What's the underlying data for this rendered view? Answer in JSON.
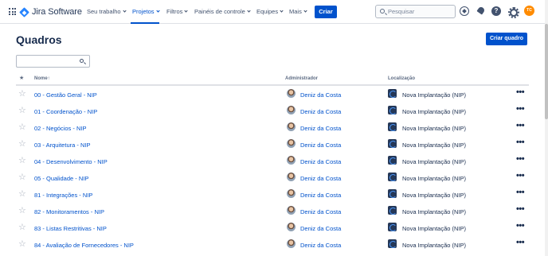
{
  "nav": {
    "brand": "Jira Software",
    "items": [
      {
        "label": "Seu trabalho",
        "dropdown": true
      },
      {
        "label": "Projetos",
        "dropdown": true,
        "active": true
      },
      {
        "label": "Filtros",
        "dropdown": true
      },
      {
        "label": "Painéis de controle",
        "dropdown": true
      },
      {
        "label": "Equipes",
        "dropdown": true
      },
      {
        "label": "Mais",
        "dropdown": true
      }
    ],
    "create_label": "Criar",
    "search_placeholder": "Pesquisar",
    "help_glyph": "?",
    "user_initials": "TC",
    "icons": [
      "app-switcher-icon",
      "compass-icon",
      "notification-bell-icon",
      "help-icon",
      "settings-gear-icon"
    ]
  },
  "page": {
    "title": "Quadros",
    "create_board_label": "Criar quadro",
    "filter_value": "",
    "columns": {
      "star": "★",
      "name": "Nome",
      "name_sort": "↑",
      "admin": "Administrador",
      "location": "Localização"
    },
    "rows": [
      {
        "name": "00 - Gestão Geral - NIP",
        "admin": "Deniz da Costa",
        "location": "Nova Implantação (NIP)"
      },
      {
        "name": "01 - Coordenação - NIP",
        "admin": "Deniz da Costa",
        "location": "Nova Implantação (NIP)"
      },
      {
        "name": "02 - Negócios - NIP",
        "admin": "Deniz da Costa",
        "location": "Nova Implantação (NIP)"
      },
      {
        "name": "03 - Arquitetura - NIP",
        "admin": "Deniz da Costa",
        "location": "Nova Implantação (NIP)"
      },
      {
        "name": "04 - Desenvolvimento - NIP",
        "admin": "Deniz da Costa",
        "location": "Nova Implantação (NIP)"
      },
      {
        "name": "05 - Qualidade - NIP",
        "admin": "Deniz da Costa",
        "location": "Nova Implantação (NIP)"
      },
      {
        "name": "81 - Integrações - NIP",
        "admin": "Deniz da Costa",
        "location": "Nova Implantação (NIP)"
      },
      {
        "name": "82 - Monitoramentos - NIP",
        "admin": "Deniz da Costa",
        "location": "Nova Implantação (NIP)"
      },
      {
        "name": "83 - Listas Restritivas - NIP",
        "admin": "Deniz da Costa",
        "location": "Nova Implantação (NIP)"
      },
      {
        "name": "84 - Avaliação de Fornecedores - NIP",
        "admin": "Deniz da Costa",
        "location": "Nova Implantação (NIP)"
      }
    ],
    "row_star_glyph": "☆",
    "row_more_glyph": "•••"
  },
  "colors": {
    "primary": "#0052cc",
    "text": "#172b4d",
    "subtle": "#5e6c84",
    "user_avatar": "#ff8b00"
  }
}
